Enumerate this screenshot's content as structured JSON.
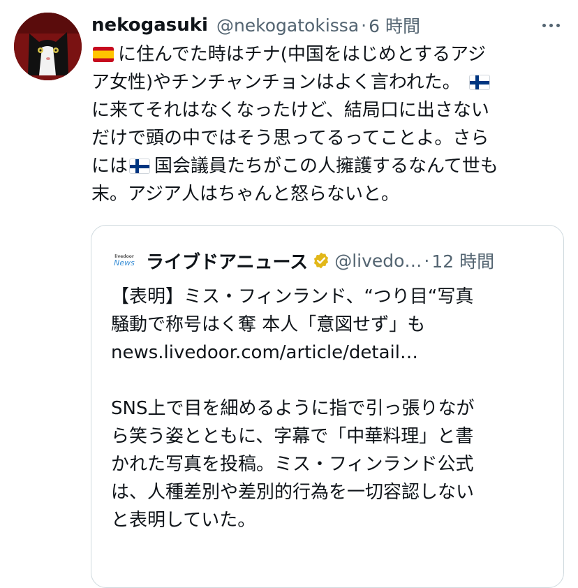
{
  "tweet": {
    "author_name": "nekogasuki",
    "handle": "@nekogatokissa",
    "separator": "·",
    "time": "6 時間",
    "avatar_icon": "cat-avatar-icon",
    "more_icon": "more-options-icon",
    "text_lines": [
      {
        "flag": "spain",
        "text": "に住んでた時はチナ(中国をはじめとするアジ"
      },
      {
        "text": "ア女性)やチンチャンチョンはよく言われた。",
        "flag_after": "finland"
      },
      {
        "text": "に来てそれはなくなったけど、結局口に出さない"
      },
      {
        "text": "だけで頭の中ではそう思ってるってことよ。さら"
      },
      {
        "text_before": "には",
        "flag_mid": "finland",
        "text": "国会議員たちがこの人擁護するなんて世も"
      },
      {
        "text": "末。アジア人はちゃんと怒らないと。"
      }
    ]
  },
  "quote": {
    "logo_small": "livedoor",
    "logo_big": "News",
    "name": "ライブドアニュース",
    "verified_icon": "verified-badge-icon",
    "verified_color": "#e2b719",
    "handle": "@livedo…",
    "separator": "·",
    "time": "12 時間",
    "text_lines": [
      "【表明】ミス・フィンランド、“つり目“写真",
      "騒動で称号はく奪 本人「意図せず」も",
      "news.livedoor.com/article/detail…",
      "",
      "SNS上で目を細めるように指で引っ張りなが",
      "ら笑う姿とともに、字幕で「中華料理」と書",
      "かれた写真を投稿。ミス・フィンランド公式",
      "は、人種差別や差別的行為を一切容認しない",
      "と表明していた。"
    ]
  },
  "colors": {
    "text": "#0f1419",
    "secondary": "#536471",
    "border": "#cfd9de",
    "spain_red": "#c60b1e",
    "spain_yellow": "#ffc400",
    "finland_blue": "#003580"
  }
}
